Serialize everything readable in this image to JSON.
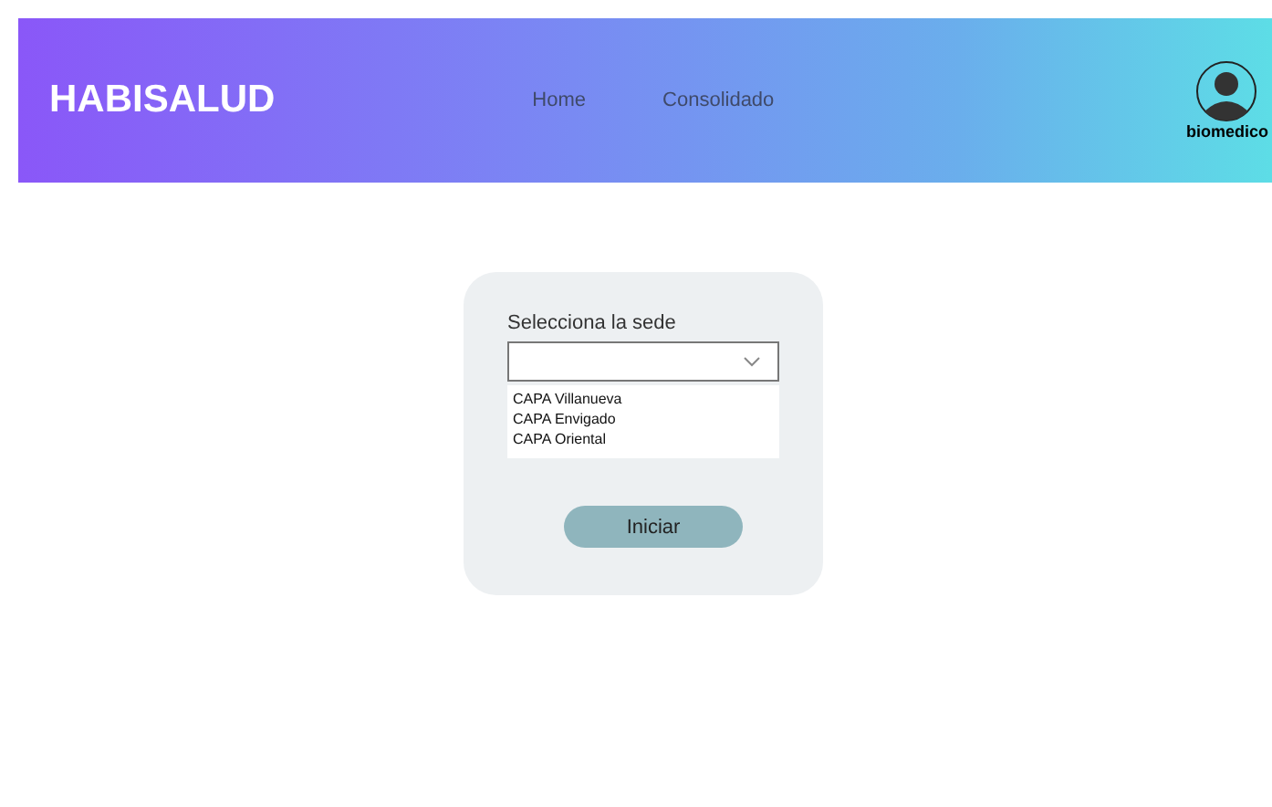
{
  "brand": "HABISALUD",
  "nav": [
    {
      "label": "Home"
    },
    {
      "label": "Consolidado"
    }
  ],
  "user": {
    "name": "biomedico"
  },
  "form": {
    "label": "Selecciona la sede",
    "options": [
      "CAPA Villanueva",
      "CAPA Envigado",
      "CAPA Oriental"
    ],
    "button": "Iniciar"
  }
}
